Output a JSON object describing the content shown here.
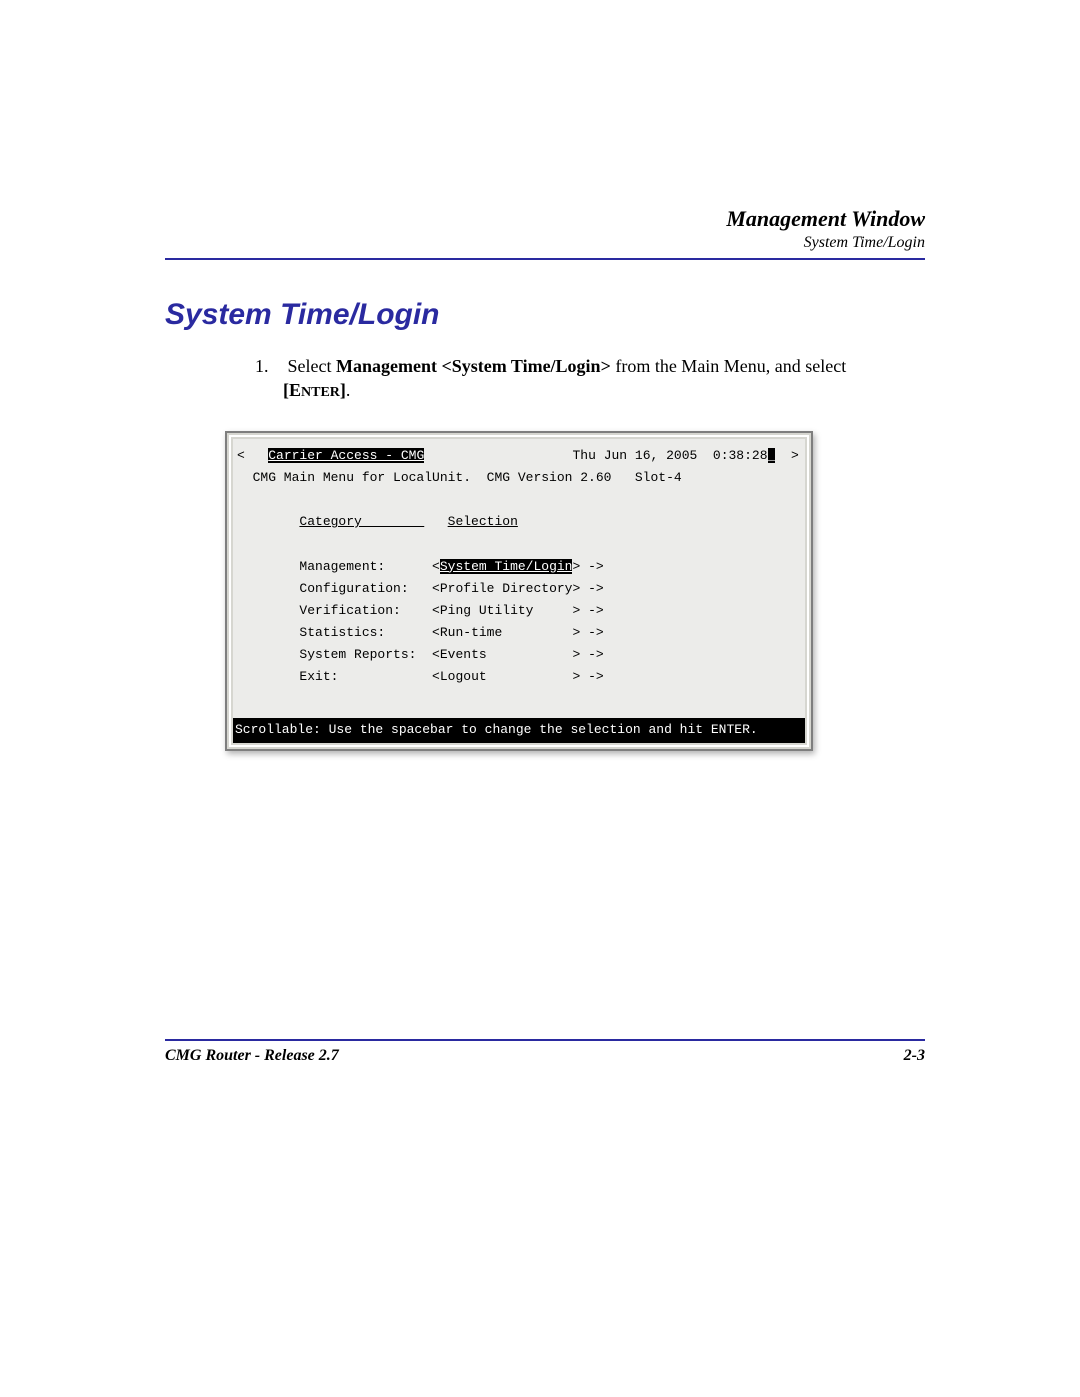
{
  "header": {
    "title": "Management Window",
    "subtitle": "System Time/Login"
  },
  "section_title": "System Time/Login",
  "instruction": {
    "number": "1.",
    "pre": "Select ",
    "bold": "Management <System Time/Login>",
    "mid": " from the Main Menu, and select ",
    "enter_open": "[E",
    "enter_small": "NTER",
    "enter_close": "]"
  },
  "terminal": {
    "lt": "<",
    "title_inv": "Carrier Access - CMG",
    "date": "Thu Jun 16, 2005  0:38:28",
    "cursor": "_",
    "gt": "  >",
    "subtitle": "  CMG Main Menu for LocalUnit.  CMG Version 2.60   Slot-4",
    "col1_header": "Category        ",
    "col2_header": "Selection",
    "rows": [
      {
        "cat": "Management:     ",
        "pre": " <",
        "sel": "System Time/Login",
        "post": "> ->"
      },
      {
        "cat": "Configuration:  ",
        "pre": " <",
        "sel": "Profile Directory",
        "post": "> ->"
      },
      {
        "cat": "Verification:   ",
        "pre": " <",
        "sel": "Ping Utility     ",
        "post": "> ->"
      },
      {
        "cat": "Statistics:     ",
        "pre": " <",
        "sel": "Run-time         ",
        "post": "> ->"
      },
      {
        "cat": "System Reports: ",
        "pre": " <",
        "sel": "Events           ",
        "post": "> ->"
      },
      {
        "cat": "Exit:           ",
        "pre": " <",
        "sel": "Logout           ",
        "post": "> ->"
      }
    ],
    "status": "Scrollable: Use the spacebar to change the selection and hit ENTER.           "
  },
  "footer": {
    "left": "CMG Router - Release 2.7",
    "right": "2-3"
  }
}
